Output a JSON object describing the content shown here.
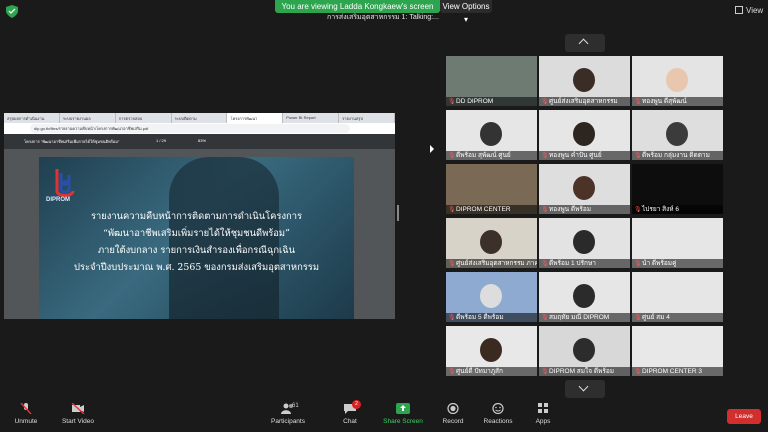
{
  "banner": {
    "text": "You are viewing Ladda Kongkaew's screen",
    "view_options": "View Options ▾"
  },
  "talking": "การส่งเสริมอุตสาหกรรม 1: Talking:...",
  "view_button": "View",
  "browser": {
    "tabs": [
      "สรุปผลการดำเนินงาน",
      "ระบบรายงานผล",
      "การตรวจสอบ",
      "ระบบติดตาม",
      "โครงการพัฒนา",
      "Power BI Report",
      "รายงานสรุป"
    ],
    "url": "dip.go.th/files/รายงานความคืบหน้า/โครงการพัฒนาอาชีพเสริม.pdf"
  },
  "pdf": {
    "name": "โครงการ \"พัฒนาอาชีพเสริมเพิ่มรายได้ให้ชุมชนติพร้อม\"",
    "page": "1 / 29",
    "zoom": "83%"
  },
  "slide": {
    "logo_text": "DIPROM",
    "lines": [
      "รายงานความคืบหน้าการติดตามการดำเนินโครงการ",
      "“พัฒนาอาชีพเสริมเพิ่มรายได้ให้ชุมชนดีพร้อม”",
      "ภายใต้งบกลาง รายการเงินสำรองเพื่อกรณีฉุกเฉิน",
      "ประจำปีงบประมาณ พ.ศ. 2565 ของกรมส่งเสริมอุตสาหกรรม"
    ]
  },
  "participants": [
    {
      "name": "DD DIPROM"
    },
    {
      "name": "ศูนย์ส่งเสริมอุตสาหกรรม"
    },
    {
      "name": "ทองพูน ดีสุพัฒน์"
    },
    {
      "name": "ดีพร้อม สุพัฒน์ ศูนย์"
    },
    {
      "name": "ทองพูน คำปัน ศูนย์"
    },
    {
      "name": "ดีพร้อม กลุ่มงาน ติดตาม"
    },
    {
      "name": "DIPROM CENTER"
    },
    {
      "name": "ทองพูน ดีพร้อม"
    },
    {
      "name": "ไปรยา สิงห์ 6"
    },
    {
      "name": "ศูนย์ส่งเสริมอุตสาหกรรม ภาค"
    },
    {
      "name": "ดีพร้อม 1 ปรักษา"
    },
    {
      "name": "นำ ดีพร้อมคู่"
    },
    {
      "name": "ดีพร้อม 5 ดีพร้อม"
    },
    {
      "name": "สมฤทัย มณี DIPROM"
    },
    {
      "name": "ศูนย์ สม 4"
    },
    {
      "name": "ศูนย์ดี ปัทมาภูสัก"
    },
    {
      "name": "DIPROM สมใจ ดีพร้อม"
    },
    {
      "name": "DIPROM CENTER 3"
    }
  ],
  "toolbar": {
    "unmute": "Unmute",
    "start_video": "Start Video",
    "participants": "Participants",
    "participants_count": "61",
    "chat": "Chat",
    "chat_badge": "2",
    "share": "Share Screen",
    "record": "Record",
    "reactions": "Reactions",
    "apps": "Apps",
    "leave": "Leave"
  },
  "colors": {
    "share": "#2da44e",
    "leave": "#d12e2e",
    "banner": "#2da44e"
  }
}
